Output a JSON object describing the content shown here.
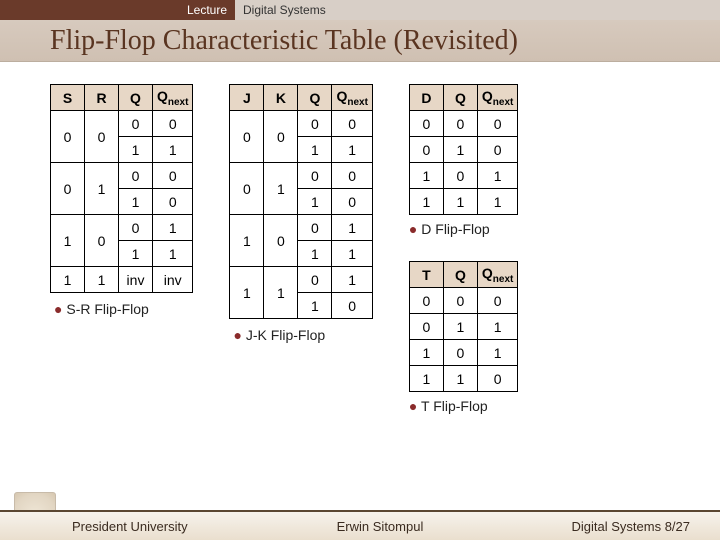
{
  "lecture": {
    "left": "Lecture",
    "right": "Digital Systems"
  },
  "title": "Flip-Flop Characteristic Table (Revisited)",
  "sr": {
    "caption": "S-R Flip-Flop",
    "headers": [
      "S",
      "R",
      "Q",
      "Qnext"
    ],
    "rows": [
      [
        "0",
        "0",
        "0",
        "0"
      ],
      [
        "",
        "",
        "1",
        "1"
      ],
      [
        "0",
        "1",
        "0",
        "0"
      ],
      [
        "",
        "",
        "1",
        "0"
      ],
      [
        "1",
        "0",
        "0",
        "1"
      ],
      [
        "",
        "",
        "1",
        "1"
      ],
      [
        "1",
        "1",
        "inv",
        "inv"
      ]
    ],
    "spans": [
      [
        0,
        2
      ],
      [
        2,
        2
      ],
      [
        4,
        2
      ],
      [
        6,
        1
      ]
    ]
  },
  "jk": {
    "caption": "J-K Flip-Flop",
    "headers": [
      "J",
      "K",
      "Q",
      "Qnext"
    ],
    "rows": [
      [
        "0",
        "0",
        "0",
        "0"
      ],
      [
        "",
        "",
        "1",
        "1"
      ],
      [
        "0",
        "1",
        "0",
        "0"
      ],
      [
        "",
        "",
        "1",
        "0"
      ],
      [
        "1",
        "0",
        "0",
        "1"
      ],
      [
        "",
        "",
        "1",
        "1"
      ],
      [
        "1",
        "1",
        "0",
        "1"
      ],
      [
        "",
        "",
        "1",
        "0"
      ]
    ],
    "spans": [
      [
        0,
        2
      ],
      [
        2,
        2
      ],
      [
        4,
        2
      ],
      [
        6,
        2
      ]
    ]
  },
  "d": {
    "caption": "D Flip-Flop",
    "headers": [
      "D",
      "Q",
      "Qnext"
    ],
    "rows": [
      [
        "0",
        "0",
        "0"
      ],
      [
        "0",
        "1",
        "0"
      ],
      [
        "1",
        "0",
        "1"
      ],
      [
        "1",
        "1",
        "1"
      ]
    ]
  },
  "t": {
    "caption": "T Flip-Flop",
    "headers": [
      "T",
      "Q",
      "Qnext"
    ],
    "rows": [
      [
        "0",
        "0",
        "0"
      ],
      [
        "0",
        "1",
        "1"
      ],
      [
        "1",
        "0",
        "1"
      ],
      [
        "1",
        "1",
        "0"
      ]
    ]
  },
  "footer": {
    "left": "President University",
    "mid": "Erwin Sitompul",
    "right": "Digital Systems 8/27"
  }
}
